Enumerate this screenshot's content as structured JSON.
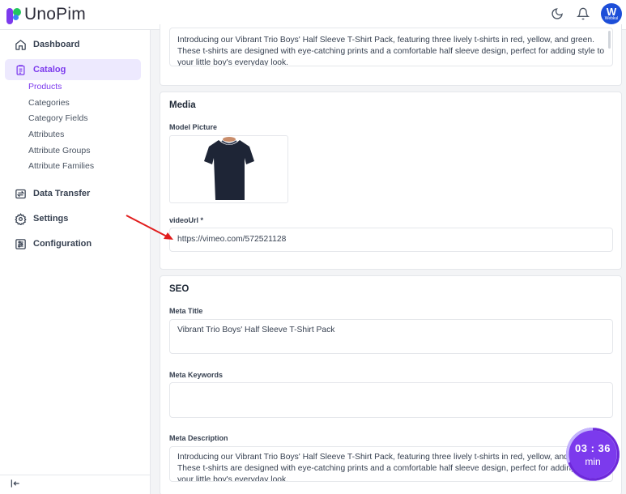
{
  "app": {
    "name": "UnoPim"
  },
  "header": {
    "avatar_letter": "W",
    "avatar_sub": "Webkul"
  },
  "sidebar": {
    "items": [
      {
        "label": "Dashboard",
        "icon": "home-icon"
      },
      {
        "label": "Catalog",
        "icon": "clipboard-icon",
        "active": true
      },
      {
        "label": "Data Transfer",
        "icon": "data-transfer-icon"
      },
      {
        "label": "Settings",
        "icon": "gear-icon"
      },
      {
        "label": "Configuration",
        "icon": "sliders-icon"
      }
    ],
    "catalog_sub": [
      "Products",
      "Categories",
      "Category Fields",
      "Attributes",
      "Attribute Groups",
      "Attribute Families"
    ]
  },
  "description": {
    "text": "Introducing our Vibrant Trio Boys' Half Sleeve T-Shirt Pack, featuring three lively t-shirts in red, yellow, and green. These t-shirts are designed with eye-catching prints and a comfortable half sleeve design, perfect for adding style to your little boy's everyday look."
  },
  "media": {
    "title": "Media",
    "model_picture_label": "Model Picture",
    "video_label": "videoUrl *",
    "video_value": "https://vimeo.com/572521128"
  },
  "seo": {
    "title": "SEO",
    "meta_title_label": "Meta Title",
    "meta_title_value": "Vibrant Trio Boys' Half Sleeve T-Shirt Pack",
    "meta_keywords_label": "Meta Keywords",
    "meta_keywords_value": "",
    "meta_description_label": "Meta Description",
    "meta_description_value": "Introducing our Vibrant Trio Boys' Half Sleeve T-Shirt Pack, featuring three lively t-shirts in red, yellow, and green. These t-shirts are designed with eye-catching prints and a comfortable half sleeve design, perfect for adding style to your little boy's everyday look."
  },
  "timer": {
    "time": "03 : 36",
    "unit": "min"
  },
  "colors": {
    "accent": "#7c3aed",
    "arrow": "#e11d1d"
  }
}
